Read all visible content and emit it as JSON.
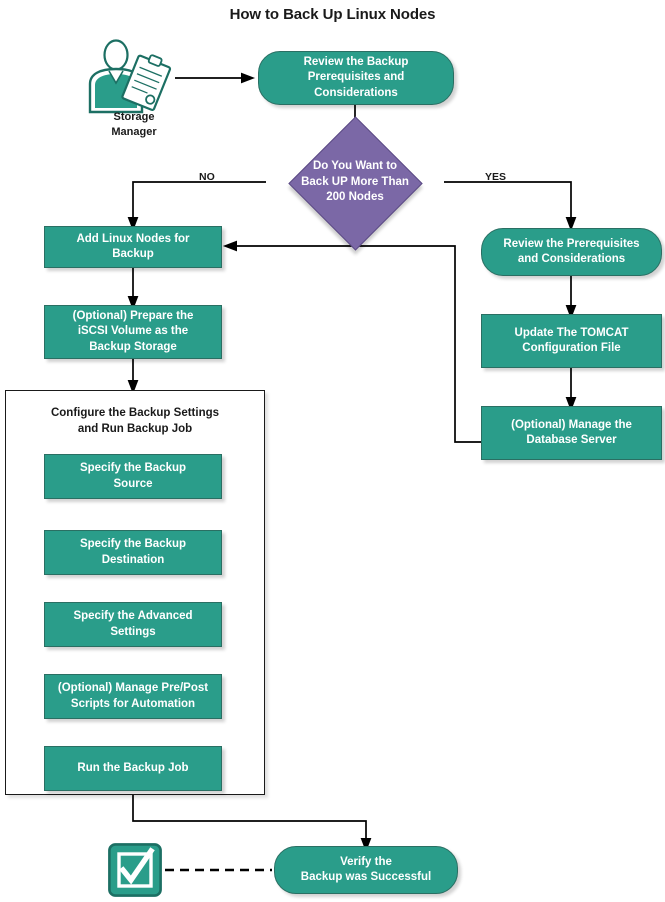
{
  "diagram": {
    "title": "How to Back Up Linux Nodes",
    "type": "flowchart",
    "colors": {
      "node_fill": "#2a9d8a",
      "node_stroke": "#2a6f63",
      "decision_fill": "#7b68a6",
      "decision_stroke": "#5b4a84",
      "node_text": "#ffffff",
      "line": "#000000",
      "label_text": "#1a1a1a",
      "background": "#ffffff"
    },
    "actor": {
      "icon": "storage-manager-person-icon",
      "caption_line1": "Storage",
      "caption_line2": "Manager"
    },
    "start_node": {
      "label": "Review the Backup Prerequisites and Considerations",
      "line1": "Review the Backup",
      "line2": "Prerequisites and",
      "line3": "Considerations",
      "shape": "rounded"
    },
    "decision": {
      "label": "Do You Want to Back UP More Than 200  Nodes",
      "line1": "Do You Want to",
      "line2": "Back UP More Than",
      "line3": "200  Nodes",
      "shape": "diamond",
      "branch_no": "NO",
      "branch_yes": "YES"
    },
    "left_branch": [
      {
        "label": "Add Linux Nodes for Backup",
        "line1": "Add Linux Nodes for",
        "line2": "Backup",
        "shape": "rect"
      },
      {
        "label": "(Optional) Prepare the iSCSI Volume as the Backup Storage",
        "line1": "(Optional) Prepare the",
        "line2": "iSCSI Volume as the",
        "line3": "Backup Storage",
        "shape": "rect"
      }
    ],
    "group": {
      "label": "Configure the Backup Settings and Run Backup Job",
      "line1": "Configure the Backup Settings",
      "line2": "and Run Backup Job",
      "steps": [
        {
          "label": "Specify the Backup Source",
          "line1": "Specify the Backup",
          "line2": "Source"
        },
        {
          "label": "Specify the Backup Destination",
          "line1": "Specify the Backup",
          "line2": "Destination"
        },
        {
          "label": "Specify the Advanced Settings",
          "line1": "Specify the Advanced",
          "line2": "Settings"
        },
        {
          "label": "(Optional) Manage Pre/Post Scripts for Automation",
          "line1": "(Optional) Manage Pre/Post",
          "line2": "Scripts for Automation"
        },
        {
          "label": "Run the Backup Job",
          "line1": "Run the Backup Job",
          "line2": ""
        }
      ]
    },
    "right_branch": [
      {
        "label": "Review the Prerequisites and Considerations",
        "line1": "Review the Prerequisites",
        "line2": "and Considerations",
        "shape": "rounded"
      },
      {
        "label": "Update The TOMCAT Configuration File",
        "line1": "Update The TOMCAT",
        "line2": "Configuration File",
        "shape": "rect"
      },
      {
        "label": "(Optional) Manage the Database Server",
        "line1": "(Optional) Manage the",
        "line2": "Database Server",
        "shape": "rect"
      }
    ],
    "end_node": {
      "label": "Verify the Backup was Successful",
      "line1": "Verify the",
      "line2": "Backup was Successful",
      "shape": "rounded",
      "icon": "checkbox-checked-icon"
    }
  }
}
